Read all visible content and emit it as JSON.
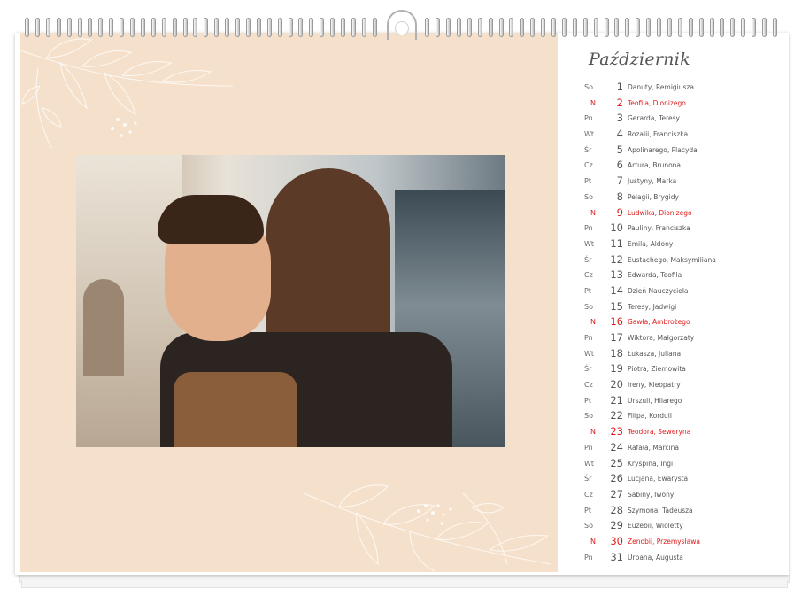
{
  "calendar": {
    "month": "Październik",
    "accent_color": "#e01b1b",
    "background_color": "#f5e1cb",
    "days": [
      {
        "dn": "So",
        "num": "1",
        "names": "Danuty, Remigiusza",
        "holiday": false
      },
      {
        "dn": "N",
        "num": "2",
        "names": "Teofila, Dionizego",
        "holiday": true
      },
      {
        "dn": "Pn",
        "num": "3",
        "names": "Gerarda, Teresy",
        "holiday": false
      },
      {
        "dn": "Wt",
        "num": "4",
        "names": "Rozalii, Franciszka",
        "holiday": false
      },
      {
        "dn": "Śr",
        "num": "5",
        "names": "Apolinarego, Placyda",
        "holiday": false
      },
      {
        "dn": "Cz",
        "num": "6",
        "names": "Artura, Brunona",
        "holiday": false
      },
      {
        "dn": "Pt",
        "num": "7",
        "names": "Justyny, Marka",
        "holiday": false
      },
      {
        "dn": "So",
        "num": "8",
        "names": "Pelagii, Brygidy",
        "holiday": false
      },
      {
        "dn": "N",
        "num": "9",
        "names": "Ludwika, Dionizego",
        "holiday": true
      },
      {
        "dn": "Pn",
        "num": "10",
        "names": "Pauliny, Franciszka",
        "holiday": false
      },
      {
        "dn": "Wt",
        "num": "11",
        "names": "Emila, Aldony",
        "holiday": false
      },
      {
        "dn": "Śr",
        "num": "12",
        "names": "Eustachego, Maksymiliana",
        "holiday": false
      },
      {
        "dn": "Cz",
        "num": "13",
        "names": "Edwarda, Teofila",
        "holiday": false
      },
      {
        "dn": "Pt",
        "num": "14",
        "names": "Dzień Nauczyciela",
        "holiday": false
      },
      {
        "dn": "So",
        "num": "15",
        "names": "Teresy, Jadwigi",
        "holiday": false
      },
      {
        "dn": "N",
        "num": "16",
        "names": "Gawła, Ambrożego",
        "holiday": true
      },
      {
        "dn": "Pn",
        "num": "17",
        "names": "Wiktora, Małgorzaty",
        "holiday": false
      },
      {
        "dn": "Wt",
        "num": "18",
        "names": "Łukasza, Juliana",
        "holiday": false
      },
      {
        "dn": "Śr",
        "num": "19",
        "names": "Piotra, Ziemowita",
        "holiday": false
      },
      {
        "dn": "Cz",
        "num": "20",
        "names": "Ireny, Kleopatry",
        "holiday": false
      },
      {
        "dn": "Pt",
        "num": "21",
        "names": "Urszuli, Hilarego",
        "holiday": false
      },
      {
        "dn": "So",
        "num": "22",
        "names": "Filipa, Korduli",
        "holiday": false
      },
      {
        "dn": "N",
        "num": "23",
        "names": "Teodora, Seweryna",
        "holiday": true
      },
      {
        "dn": "Pn",
        "num": "24",
        "names": "Rafała, Marcina",
        "holiday": false
      },
      {
        "dn": "Wt",
        "num": "25",
        "names": "Kryspina, Ingi",
        "holiday": false
      },
      {
        "dn": "Śr",
        "num": "26",
        "names": "Lucjana, Ewarysta",
        "holiday": false
      },
      {
        "dn": "Cz",
        "num": "27",
        "names": "Sabiny, Iwony",
        "holiday": false
      },
      {
        "dn": "Pt",
        "num": "28",
        "names": "Szymona, Tadeusza",
        "holiday": false
      },
      {
        "dn": "So",
        "num": "29",
        "names": "Euzebii, Wioletty",
        "holiday": false
      },
      {
        "dn": "N",
        "num": "30",
        "names": "Zenobii, Przemysława",
        "holiday": true
      },
      {
        "dn": "Pn",
        "num": "31",
        "names": "Urbana, Augusta",
        "holiday": false
      }
    ]
  },
  "photo": {
    "subject": "couple-photo"
  }
}
